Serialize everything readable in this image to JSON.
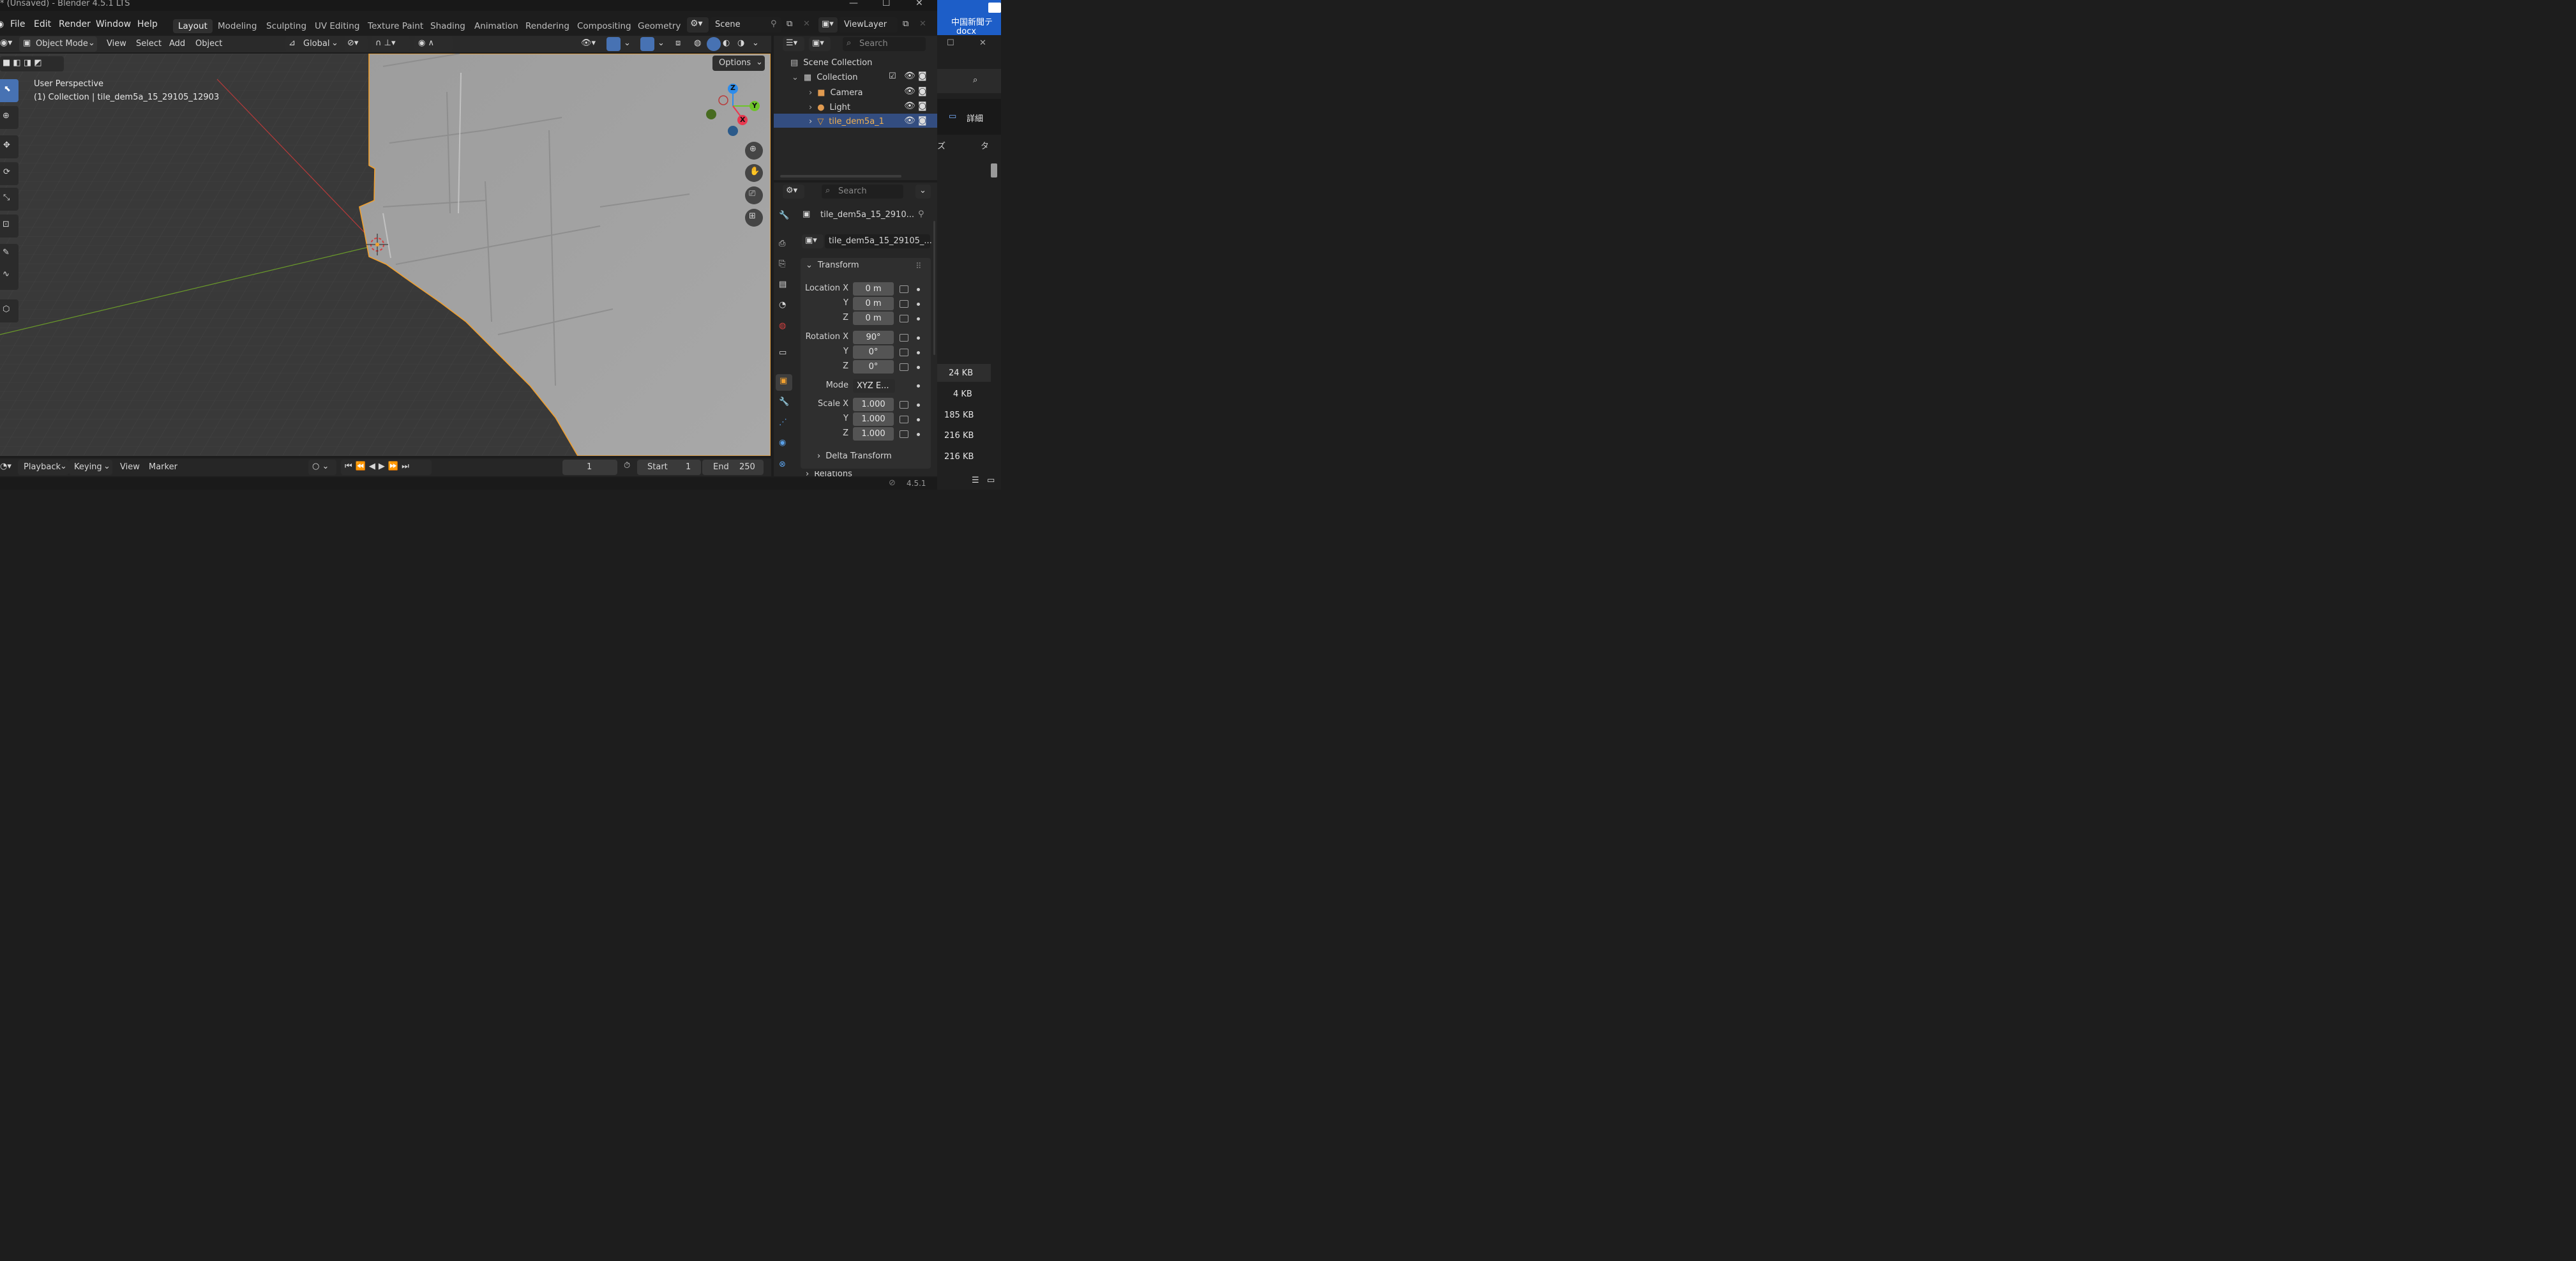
{
  "window": {
    "title": "* (Unsaved) - Blender 4.5.1 LTS"
  },
  "menu": {
    "file": "File",
    "edit": "Edit",
    "render": "Render",
    "window": "Window",
    "help": "Help"
  },
  "workspaces": [
    "Layout",
    "Modeling",
    "Sculpting",
    "UV Editing",
    "Texture Paint",
    "Shading",
    "Animation",
    "Rendering",
    "Compositing",
    "Geometry N"
  ],
  "scene": {
    "name": "Scene",
    "view_layer": "ViewLayer"
  },
  "viewport_header": {
    "mode": "Object Mode",
    "view": "View",
    "select": "Select",
    "add": "Add",
    "object": "Object",
    "orientation": "Global",
    "options": "Options"
  },
  "viewport": {
    "perspective": "User Perspective",
    "collection_line": "(1) Collection | tile_dem5a_15_29105_12903"
  },
  "gizmo": {
    "z": "Z",
    "y": "Y",
    "x": "X"
  },
  "outliner": {
    "search_placeholder": "Search",
    "scene_collection": "Scene Collection",
    "collection": "Collection",
    "items": [
      {
        "label": "Camera",
        "icon": "camera-icon",
        "selected": false
      },
      {
        "label": "Light",
        "icon": "light-icon",
        "selected": false
      },
      {
        "label": "tile_dem5a_1",
        "icon": "mesh-icon",
        "selected": true
      }
    ]
  },
  "properties": {
    "search_placeholder": "Search",
    "object_name": "tile_dem5a_15_2910...",
    "object_field": "tile_dem5a_15_29105_...",
    "transform_title": "Transform",
    "location_label": "Location X",
    "rotation_label": "Rotation X",
    "scale_label": "Scale X",
    "y_label": "Y",
    "z_label": "Z",
    "mode_label": "Mode",
    "location": {
      "x": "0 m",
      "y": "0 m",
      "z": "0 m"
    },
    "rotation": {
      "x": "90°",
      "y": "0°",
      "z": "0°"
    },
    "mode": "XYZ E...",
    "scale": {
      "x": "1.000",
      "y": "1.000",
      "z": "1.000"
    },
    "delta_transform": "Delta Transform",
    "relations": "Relations"
  },
  "timeline": {
    "playback": "Playback",
    "keying": "Keying",
    "view": "View",
    "marker": "Marker",
    "current_frame": "1",
    "start_label": "Start",
    "start": "1",
    "end_label": "End",
    "end": "250"
  },
  "status": {
    "version": "4.5.1"
  },
  "background_app": {
    "title_a": "中国新聞テ",
    "title_b": "docx",
    "details": "詳細",
    "col1": "ズ",
    "col2": "タ",
    "sizes": [
      "24 KB",
      "4 KB",
      "185 KB",
      "216 KB",
      "216 KB"
    ]
  },
  "colors": {
    "accent_blue": "#4772b3",
    "selection_orange": "#f0a030",
    "axis_red": "#c83c3c",
    "axis_green": "#6a9a2a",
    "gizmo_x": "#e8384f",
    "gizmo_y": "#6ec42a",
    "gizmo_z": "#2d8ceb"
  }
}
